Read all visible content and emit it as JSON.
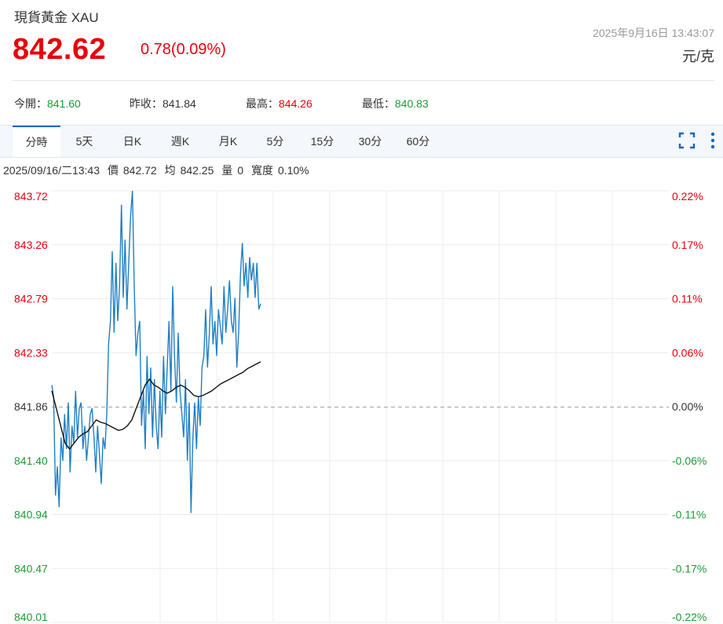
{
  "header": {
    "title": "現貨黃金 XAU",
    "price": "842.62",
    "change": "0.78(0.09%)",
    "datetime": "2025年9月16日 13:43:07",
    "unit": "元/克"
  },
  "stats": [
    {
      "label": "今開：",
      "value": "841.60",
      "trend": "down"
    },
    {
      "label": "昨收：",
      "value": "841.84",
      "trend": "flat"
    },
    {
      "label": "最高：",
      "value": "844.26",
      "trend": "up"
    },
    {
      "label": "最低：",
      "value": "840.83",
      "trend": "down"
    }
  ],
  "tabs": [
    "分時",
    "5天",
    "日K",
    "週K",
    "月K",
    "5分",
    "15分",
    "30分",
    "60分"
  ],
  "active_tab": 0,
  "icons": {
    "fullscreen": "fullscreen-icon",
    "more": "more-vertical-icon"
  },
  "info": {
    "datetime": "2025/09/16/二13:43",
    "price_label": "價",
    "price": "842.72",
    "avg_label": "均",
    "avg": "842.25",
    "vol_label": "量",
    "vol": "0",
    "width_label": "寬度",
    "width": "0.10%"
  },
  "colors": {
    "up": "#e8000b",
    "down": "#1a9b34",
    "price_line": "#1f7fc4",
    "avg_line": "#111111",
    "baseline": "#999999",
    "tab_accent": "#1565c0"
  },
  "chart_data": {
    "type": "line",
    "prev_close": 841.86,
    "ylim": [
      840.01,
      843.72
    ],
    "y_ticks_left": [
      "843.72",
      "843.26",
      "842.79",
      "842.33",
      "841.86",
      "841.40",
      "840.94",
      "840.47",
      "840.01"
    ],
    "y_ticks_right": [
      "0.22%",
      "0.17%",
      "0.11%",
      "0.06%",
      "0.00%",
      "-0.06%",
      "-0.11%",
      "-0.17%",
      "-0.22%"
    ],
    "x_sessions": 12,
    "grid": true,
    "series": [
      {
        "values": [
          842.05,
          841.95,
          841.1,
          841.35,
          841.0,
          841.6,
          841.4,
          841.8,
          841.5,
          841.9,
          841.3,
          841.7,
          841.55,
          842.0,
          841.6,
          841.85,
          841.9,
          841.5,
          841.7,
          841.4,
          841.6,
          841.8,
          841.85,
          841.6,
          841.3,
          841.7,
          841.45,
          841.2,
          841.6,
          841.5,
          841.8,
          842.4,
          842.6,
          843.2,
          842.5,
          843.1,
          842.6,
          842.9,
          843.6,
          842.8,
          843.3,
          842.7,
          843.1,
          843.5,
          843.72,
          842.9,
          842.3,
          842.5,
          842.6,
          841.7,
          842.0,
          841.5,
          842.3,
          841.8,
          842.2,
          841.6,
          842.1,
          841.7,
          841.5,
          842.0,
          841.6,
          842.3,
          841.8,
          842.2,
          842.6,
          842.0,
          842.9,
          842.3,
          841.9,
          842.5,
          842.0,
          841.8,
          841.6,
          842.1,
          841.4,
          841.9,
          840.95,
          841.6,
          841.9,
          841.5,
          841.95,
          841.7,
          842.2,
          842.3,
          842.7,
          842.2,
          842.5,
          842.9,
          842.4,
          842.6,
          842.3,
          842.7,
          842.55,
          842.4,
          842.9,
          842.5,
          842.7,
          842.95,
          842.6,
          842.5,
          842.8,
          842.2,
          842.5,
          843.0,
          843.27,
          842.9,
          843.1,
          842.8,
          843.15,
          842.95,
          843.1,
          842.8,
          843.1,
          842.7,
          842.75
        ]
      },
      {
        "values": [
          842.0,
          841.85,
          841.7,
          841.55,
          841.5,
          841.55,
          841.6,
          841.63,
          841.65,
          841.7,
          841.75,
          841.73,
          841.72,
          841.7,
          841.68,
          841.66,
          841.67,
          841.7,
          841.75,
          841.85,
          841.95,
          842.05,
          842.1,
          842.05,
          842.03,
          842.0,
          841.98,
          842.0,
          842.03,
          842.05,
          842.03,
          842.0,
          841.96,
          841.95,
          841.96,
          841.98,
          842.0,
          842.03,
          842.06,
          842.08,
          842.1,
          842.12,
          842.14,
          842.16,
          842.19,
          842.21,
          842.23,
          842.25
        ]
      }
    ]
  }
}
